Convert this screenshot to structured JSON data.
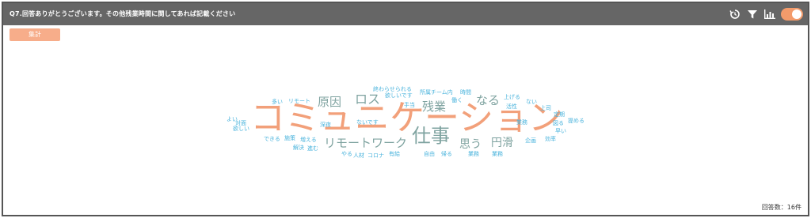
{
  "header": {
    "title": "Q7.回答ありがとうございます。その他残業時間に関してあれば記載ください"
  },
  "toolbar": {
    "icons": [
      "history-icon",
      "filter-icon",
      "bar-chart-icon"
    ],
    "toggle_on": true,
    "accent": "#f39b6b"
  },
  "aggregate_button": {
    "label": "集計"
  },
  "wordcloud": {
    "colors": {
      "large": "#f2a07a",
      "medium": "#7fa3a0",
      "small": "#49b3dc"
    },
    "words": [
      "コミュニケーション",
      "仕事",
      "ロス",
      "原因",
      "残業",
      "なる",
      "思う",
      "円滑",
      "リモートワーク",
      "終わらせられる",
      "欲しいです",
      "手当",
      "所属チーム内",
      "働く",
      "時間",
      "上げる",
      "活性",
      "ない",
      "上司",
      "定期",
      "図る",
      "提める",
      "早い",
      "効率",
      "企画",
      "業務",
      "自由",
      "帰る",
      "業務",
      "有給",
      "人材",
      "コロナ",
      "やる",
      "解決",
      "進む",
      "増える",
      "施策",
      "深夜",
      "できる",
      "対面",
      "よい",
      "欲しい",
      "多い",
      "リモート",
      "ないです",
      "業務"
    ]
  },
  "footer": {
    "response_count": "回答数：16件"
  }
}
